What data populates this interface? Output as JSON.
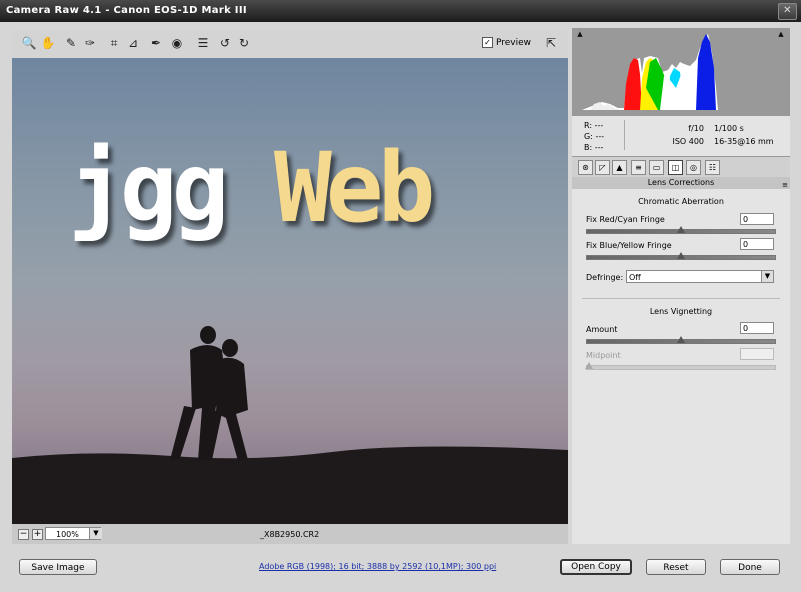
{
  "window": {
    "title": "Camera Raw 4.1  -  Canon EOS-1D Mark III",
    "close_glyph": "✕"
  },
  "toolbar": {
    "tools": [
      {
        "name": "zoom-tool",
        "glyph": "🔍"
      },
      {
        "name": "hand-tool",
        "glyph": "✋"
      },
      {
        "name": "white-balance-tool",
        "glyph": "✎"
      },
      {
        "name": "color-sampler-tool",
        "glyph": "✑"
      },
      {
        "name": "crop-tool",
        "glyph": "⌗"
      },
      {
        "name": "straighten-tool",
        "glyph": "⊿"
      },
      {
        "name": "retouch-tool",
        "glyph": "✒"
      },
      {
        "name": "red-eye-tool",
        "glyph": "◉"
      },
      {
        "name": "preferences-tool",
        "glyph": "☰"
      },
      {
        "name": "rotate-ccw-tool",
        "glyph": "↺"
      },
      {
        "name": "rotate-cw-tool",
        "glyph": "↻"
      }
    ],
    "preview_label": "Preview",
    "preview_checked": "✓",
    "fullscreen_glyph": "⇱"
  },
  "image": {
    "logo_left": "jgg",
    "logo_right": "Web"
  },
  "statusbar": {
    "zoom_minus": "−",
    "zoom_plus": "+",
    "zoom_value": "100%",
    "zoom_arrow": "▼",
    "filename": "_X8B2950.CR2"
  },
  "histogram": {
    "shadow_clip_glyph": "▲",
    "highlight_clip_glyph": "▲"
  },
  "info": {
    "r": "R:  ---",
    "g": "G:  ---",
    "b": "B:  ---",
    "aperture": "f/10",
    "iso": "ISO 400",
    "shutter": "1/100 s",
    "lens": "16-35@16 mm"
  },
  "tabs": [
    {
      "name": "basic",
      "glyph": "⊛"
    },
    {
      "name": "tone-curve",
      "glyph": "◸"
    },
    {
      "name": "detail",
      "glyph": "▲"
    },
    {
      "name": "hsl",
      "glyph": "≡"
    },
    {
      "name": "split-toning",
      "glyph": "▭"
    },
    {
      "name": "lens-corrections",
      "glyph": "◫"
    },
    {
      "name": "camera-calibration",
      "glyph": "◎"
    },
    {
      "name": "presets",
      "glyph": "☷"
    }
  ],
  "panel": {
    "title": "Lens Corrections",
    "menu_glyph": "≡",
    "chromatic_heading": "Chromatic Aberration",
    "red_cyan": {
      "label": "Fix Red/Cyan Fringe",
      "value": "0"
    },
    "blue_yellow": {
      "label": "Fix Blue/Yellow Fringe",
      "value": "0"
    },
    "defringe": {
      "label": "Defringe:",
      "value": "Off",
      "arrow": "▼"
    },
    "vignetting_heading": "Lens Vignetting",
    "amount": {
      "label": "Amount",
      "value": "0"
    },
    "midpoint": {
      "label": "Midpoint",
      "value": ""
    }
  },
  "buttons": {
    "save_image": "Save Image",
    "workflow_link": "Adobe RGB (1998); 16 bit; 3888 by 2592 (10,1MP); 300 ppi",
    "open_copy": "Open Copy",
    "reset": "Reset",
    "done": "Done"
  }
}
